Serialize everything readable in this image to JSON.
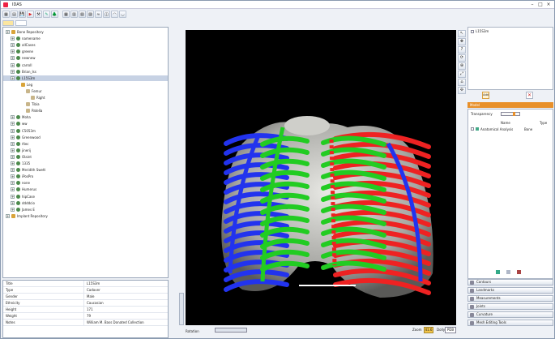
{
  "window": {
    "title": "IDAS",
    "controls": [
      "–",
      "□",
      "×"
    ]
  },
  "toolbar": {
    "buttons": [
      "new-icon",
      "open-icon",
      "save-icon",
      "play-icon",
      "tools-icon",
      "edit-icon",
      "tree-icon",
      "grid-icon",
      "layout-icon",
      "chart-icon",
      "render-icon",
      "wave-icon",
      "split-icon",
      "wifi-icon",
      "signal-icon"
    ]
  },
  "tabs": [
    "",
    ""
  ],
  "tree": {
    "items": [
      {
        "label": "Bone Repository",
        "level": 0,
        "kind": "folder"
      },
      {
        "label": "namename",
        "level": 1,
        "kind": "user"
      },
      {
        "label": "allCases",
        "level": 1,
        "kind": "user"
      },
      {
        "label": "greene",
        "level": 1,
        "kind": "user"
      },
      {
        "label": "newnew",
        "level": 1,
        "kind": "user"
      },
      {
        "label": "carroll",
        "level": 1,
        "kind": "user"
      },
      {
        "label": "Brian_Iss",
        "level": 1,
        "kind": "user"
      },
      {
        "label": "L15S3m",
        "level": 1,
        "kind": "user",
        "selected": true
      },
      {
        "label": "Leg",
        "level": 2,
        "kind": "folder"
      },
      {
        "label": "Femur",
        "level": 3,
        "kind": "bone"
      },
      {
        "label": "Right",
        "level": 4,
        "kind": "bone"
      },
      {
        "label": "Tibia",
        "level": 3,
        "kind": "bone"
      },
      {
        "label": "Patella",
        "level": 3,
        "kind": "bone"
      },
      {
        "label": "Moha",
        "level": 1,
        "kind": "user"
      },
      {
        "label": "ww",
        "level": 1,
        "kind": "user"
      },
      {
        "label": "C5053m",
        "level": 1,
        "kind": "user"
      },
      {
        "label": "Greenwood",
        "level": 1,
        "kind": "user"
      },
      {
        "label": "Alec",
        "level": 1,
        "kind": "user"
      },
      {
        "label": "jinerij",
        "level": 1,
        "kind": "user"
      },
      {
        "label": "Olaint",
        "level": 1,
        "kind": "user"
      },
      {
        "label": "1335",
        "level": 1,
        "kind": "user"
      },
      {
        "label": "Meridith Swett",
        "level": 1,
        "kind": "user"
      },
      {
        "label": "iPosPro",
        "level": 1,
        "kind": "user"
      },
      {
        "label": "none",
        "level": 1,
        "kind": "user"
      },
      {
        "label": "Humerus",
        "level": 1,
        "kind": "user"
      },
      {
        "label": "hipCase",
        "level": 1,
        "kind": "user"
      },
      {
        "label": "ddddcio",
        "level": 1,
        "kind": "user"
      },
      {
        "label": "James E",
        "level": 1,
        "kind": "user"
      },
      {
        "label": "Implant Repository",
        "level": 0,
        "kind": "folder"
      }
    ]
  },
  "properties": [
    {
      "key": "Title",
      "value": "L15S3m"
    },
    {
      "key": "Type",
      "value": "Cadaver"
    },
    {
      "key": "Gender",
      "value": "Male"
    },
    {
      "key": "Ethnicity",
      "value": "Caucasian"
    },
    {
      "key": "Height",
      "value": "171"
    },
    {
      "key": "Weight",
      "value": "79"
    },
    {
      "key": "Notes",
      "value": "William M. Bass Donated Collection"
    }
  ],
  "viewport": {
    "bottom": {
      "rotation_label": "Rotation",
      "zoom_label": "Zoom",
      "zoom_value": "41.6",
      "dolly_label": "Dolly",
      "dolly_value": "PDB"
    }
  },
  "right_panel": {
    "model_label": "L15S3m",
    "add_label": "Add",
    "model_header": "Model",
    "transparency_label": "Transparency",
    "col_name": "Name",
    "col_type": "Type",
    "row_name": "Anatomical Analysis",
    "row_type": "Bone",
    "accordion": [
      "Contours",
      "Landmarks",
      "Measurements",
      "Joints",
      "Curvature",
      "Mesh Editing Tools"
    ]
  },
  "colors": {
    "accent": "#e8902a",
    "selection": "#c7d2e4",
    "green": "#22cc22",
    "red": "#ee2222",
    "blue": "#2233ee"
  }
}
